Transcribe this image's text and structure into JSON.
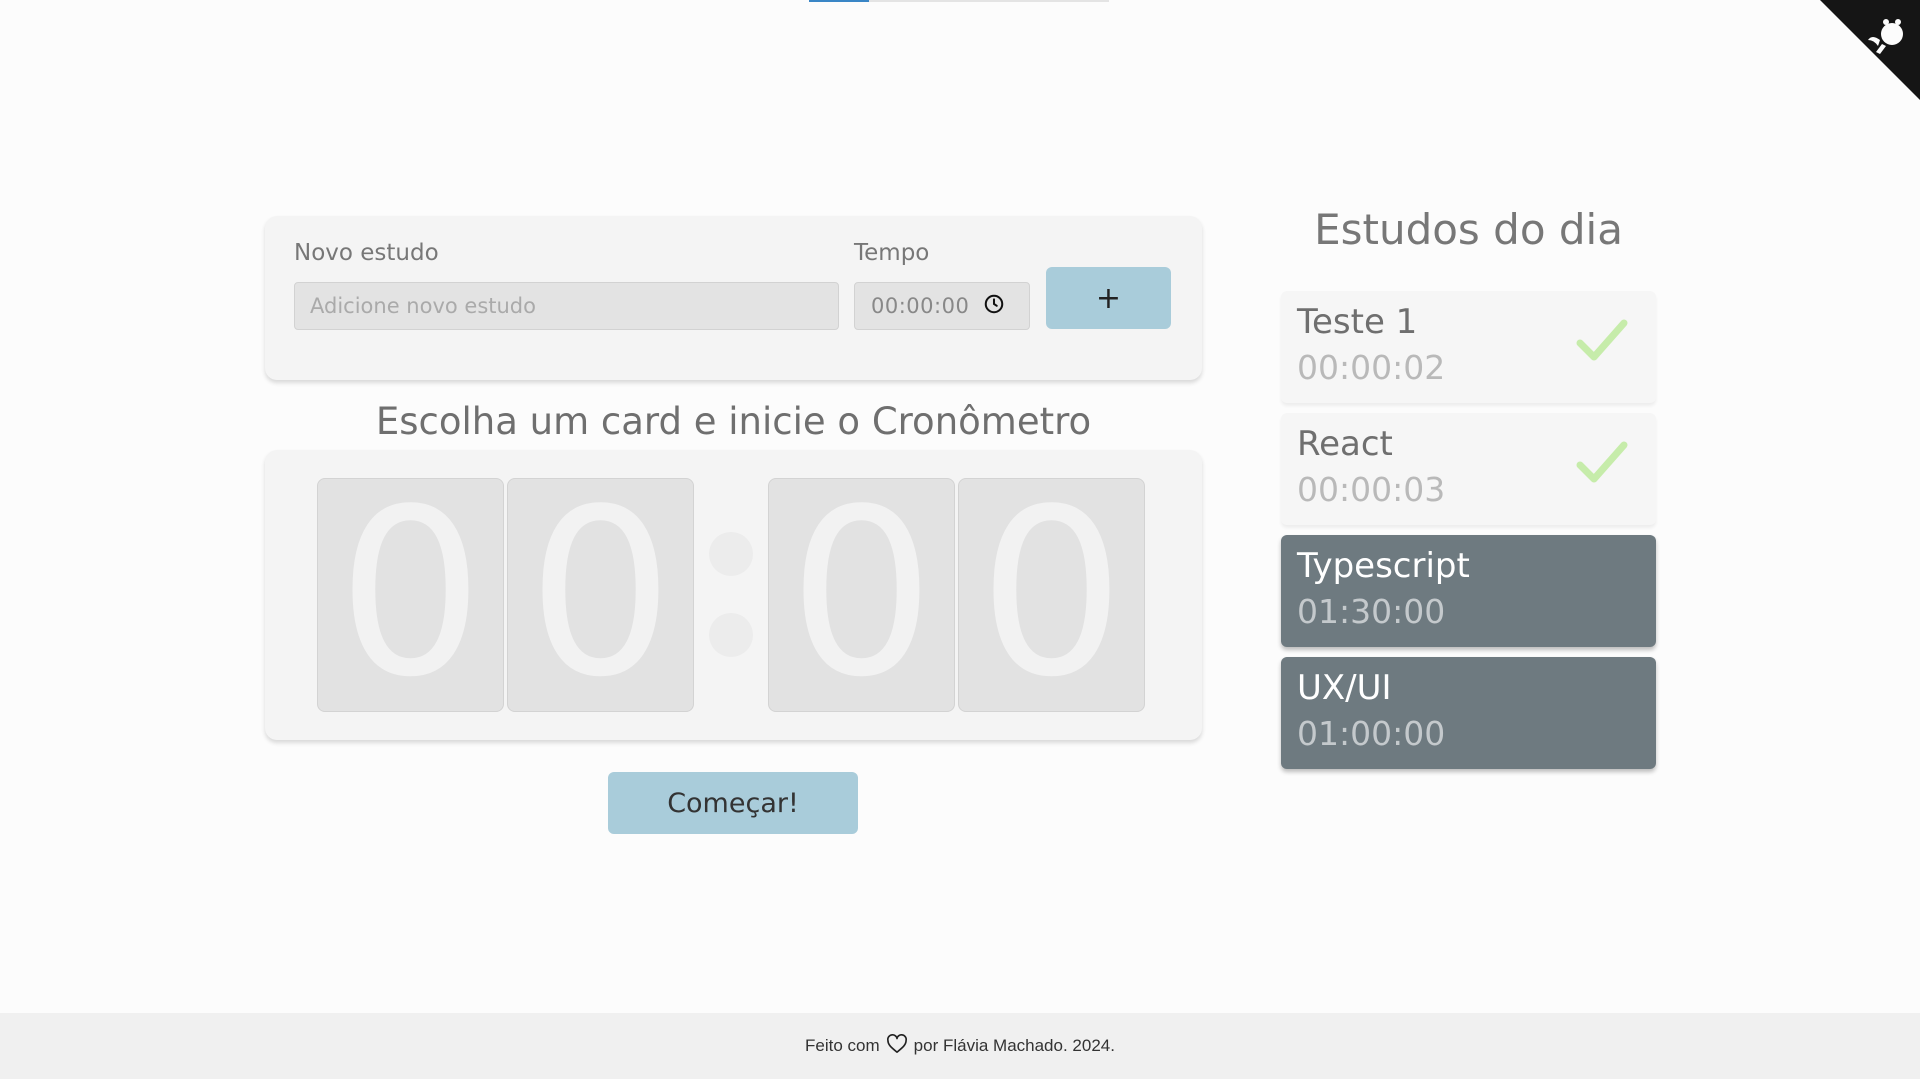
{
  "form": {
    "study_label": "Novo estudo",
    "study_placeholder": "Adicione novo estudo",
    "time_label": "Tempo",
    "time_value": "00:00:00",
    "add_label": "+"
  },
  "timer": {
    "title": "Escolha um card e inicie o Cronômetro",
    "digits": [
      "0",
      "0",
      "0",
      "0"
    ],
    "start_label": "Começar!"
  },
  "studies": {
    "title": "Estudos do dia",
    "items": [
      {
        "name": "Teste 1",
        "time": "00:00:02",
        "completed": true
      },
      {
        "name": "React",
        "time": "00:00:03",
        "completed": true
      },
      {
        "name": "Typescript",
        "time": "01:30:00",
        "completed": false
      },
      {
        "name": "UX/UI",
        "time": "01:00:00",
        "completed": false
      }
    ]
  },
  "footer": {
    "prefix": "Feito com",
    "suffix": "por Flávia Machado. 2024."
  },
  "colors": {
    "accent": "#a9ccda",
    "pending_card": "#6e7a80",
    "check": "#c6ecaa"
  },
  "icons": {
    "clock": "clock-icon",
    "check": "check-icon",
    "heart": "heart-icon",
    "github": "github-corner-icon"
  }
}
